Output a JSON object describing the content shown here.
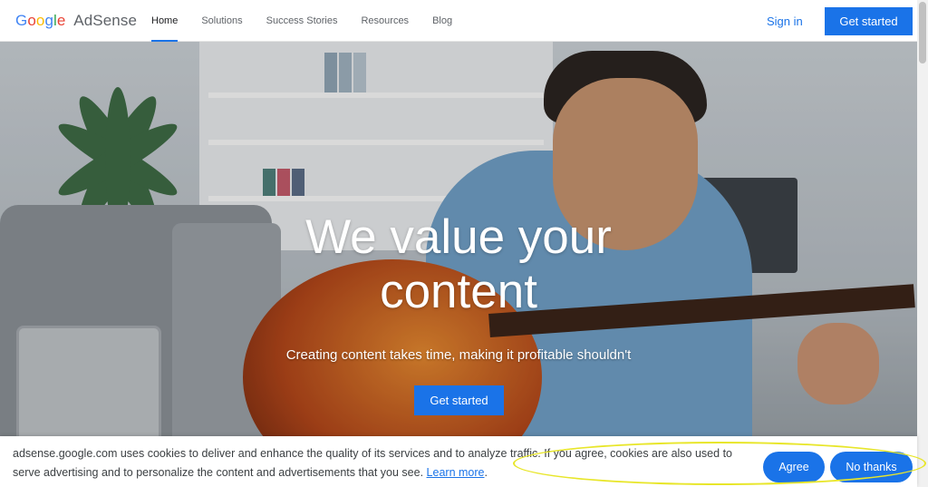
{
  "header": {
    "logo": {
      "google": "Google",
      "product": "AdSense"
    },
    "nav": [
      {
        "label": "Home",
        "active": true
      },
      {
        "label": "Solutions",
        "active": false
      },
      {
        "label": "Success Stories",
        "active": false
      },
      {
        "label": "Resources",
        "active": false
      },
      {
        "label": "Blog",
        "active": false
      }
    ],
    "sign_in_label": "Sign in",
    "get_started_label": "Get started"
  },
  "hero": {
    "title_line1": "We value your",
    "title_line2": "content",
    "subtitle": "Creating content takes time, making it profitable shouldn't",
    "cta_label": "Get started"
  },
  "cookie_banner": {
    "text": "adsense.google.com uses cookies to deliver and enhance the quality of its services and to analyze traffic. If you agree, cookies are also used to serve advertising and to personalize the content and advertisements that you see.",
    "learn_more_label": "Learn more",
    "agree_label": "Agree",
    "no_thanks_label": "No thanks"
  },
  "colors": {
    "accent": "#1a73e8",
    "highlight_annotation": "#e8e62a"
  }
}
